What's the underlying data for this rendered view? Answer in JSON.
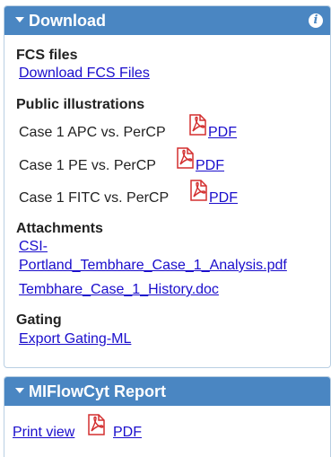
{
  "download": {
    "title": "Download",
    "fcs": {
      "heading": "FCS files",
      "link": "Download FCS Files"
    },
    "illustrations": {
      "heading": "Public illustrations",
      "items": [
        {
          "label": "Case 1 APC vs. PerCP",
          "pdf": "PDF"
        },
        {
          "label": "Case 1 PE vs. PerCP",
          "pdf": "PDF"
        },
        {
          "label": "Case 1 FITC vs. PerCP",
          "pdf": "PDF"
        }
      ]
    },
    "attachments": {
      "heading": "Attachments",
      "items": [
        {
          "line1": "CSI-",
          "line2": "Portland_Tembhare_Case_1_Analysis.pdf"
        },
        {
          "line1": "Tembhare_Case_1_History.doc"
        }
      ]
    },
    "gating": {
      "heading": "Gating",
      "link": "Export Gating-ML"
    }
  },
  "report": {
    "title": "MIFlowCyt Report",
    "print_view": "Print view",
    "pdf": "PDF"
  },
  "icons": {
    "info": "info-icon",
    "pdf": "pdf-file-icon",
    "caret": "caret-down-icon"
  },
  "colors": {
    "header_bg": "#4a86c2",
    "link": "#1a0dcc",
    "pdf_red": "#d32f2f"
  }
}
